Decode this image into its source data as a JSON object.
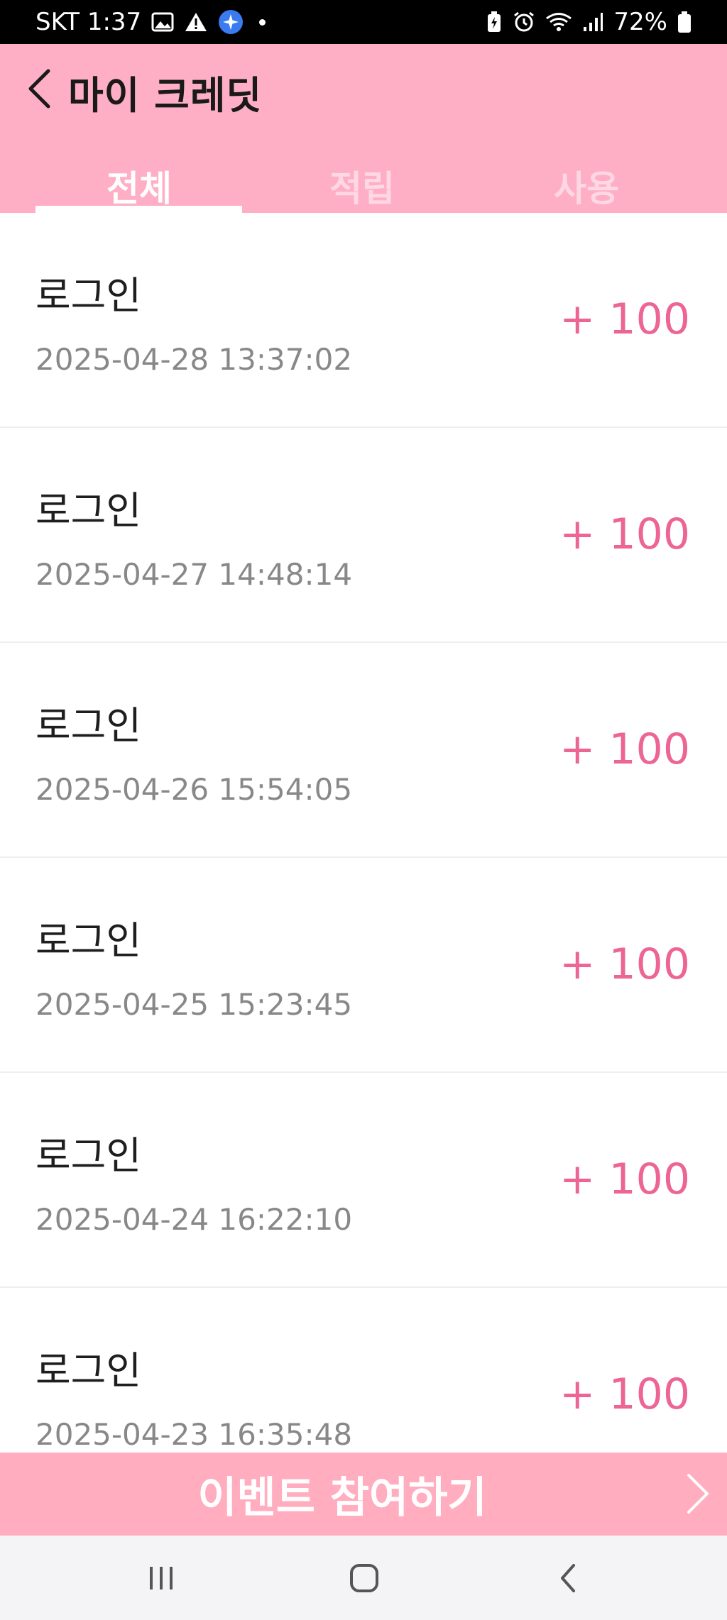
{
  "status_bar": {
    "carrier_time": "SKT 1:37",
    "battery": "72%"
  },
  "header": {
    "title": "마이 크레딧",
    "tabs": [
      {
        "label": "전체",
        "active": true
      },
      {
        "label": "적립",
        "active": false
      },
      {
        "label": "사용",
        "active": false
      }
    ]
  },
  "credits": [
    {
      "title": "로그인",
      "date": "2025-04-28 13:37:02",
      "amount": "+ 100"
    },
    {
      "title": "로그인",
      "date": "2025-04-27 14:48:14",
      "amount": "+ 100"
    },
    {
      "title": "로그인",
      "date": "2025-04-26 15:54:05",
      "amount": "+ 100"
    },
    {
      "title": "로그인",
      "date": "2025-04-25 15:23:45",
      "amount": "+ 100"
    },
    {
      "title": "로그인",
      "date": "2025-04-24 16:22:10",
      "amount": "+ 100"
    },
    {
      "title": "로그인",
      "date": "2025-04-23 16:35:48",
      "amount": "+ 100"
    }
  ],
  "event_banner": {
    "label": "이벤트 참여하기"
  },
  "colors": {
    "header_bg": "#ffafc5",
    "amount": "#ec6595",
    "banner_bg": "#ffadbf"
  },
  "icons": {
    "status_left": [
      "gallery-icon",
      "warning-icon",
      "assistant-icon"
    ],
    "status_right": [
      "battery-saver-icon",
      "alarm-icon",
      "wifi-icon",
      "signal-icon",
      "battery-icon"
    ],
    "nav": [
      "recent-apps-icon",
      "home-icon",
      "back-icon"
    ]
  }
}
